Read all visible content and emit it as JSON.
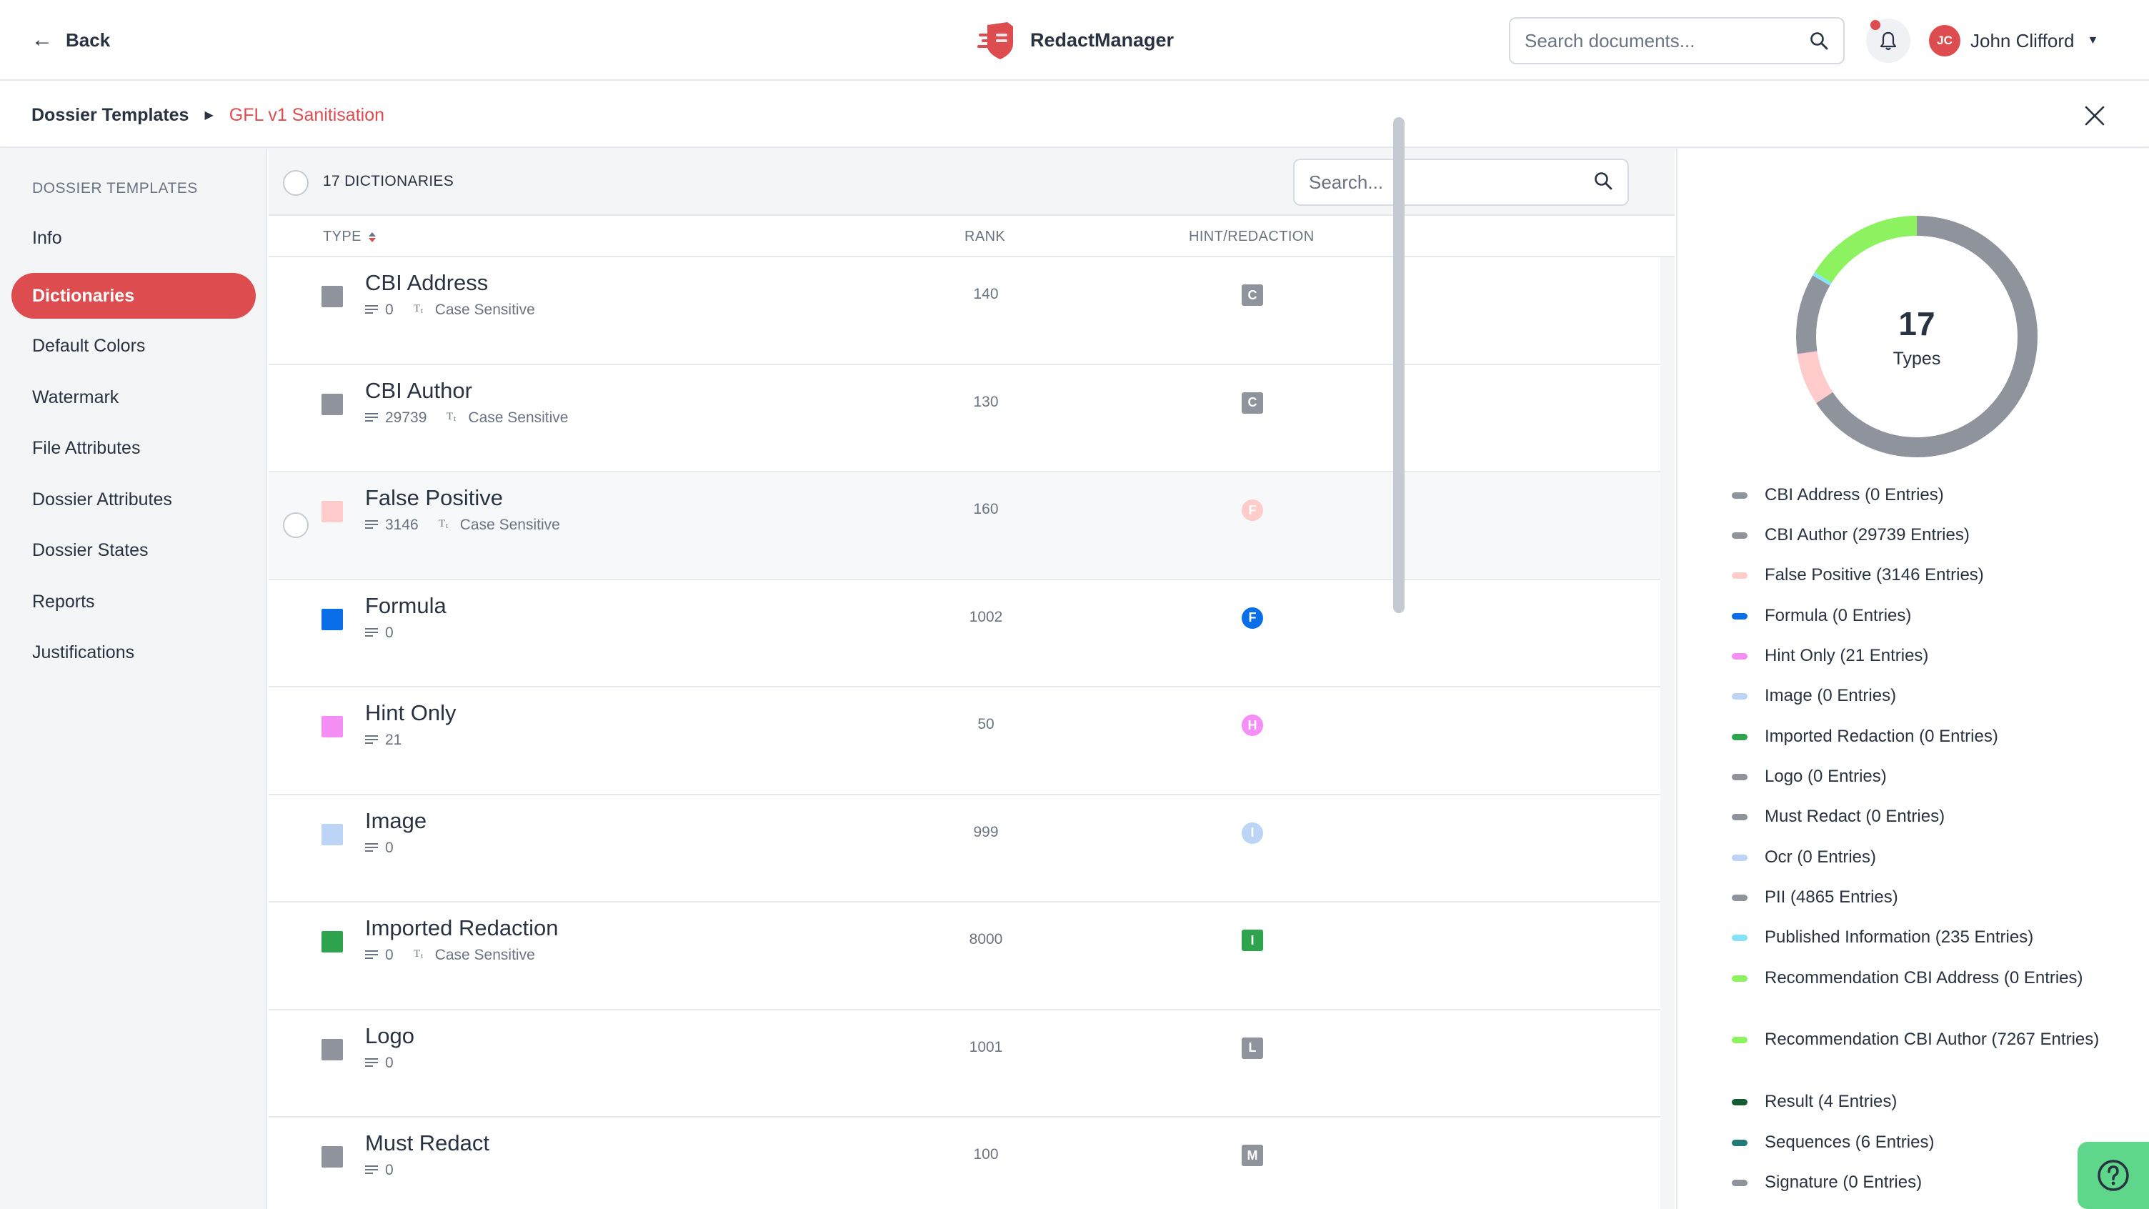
{
  "header": {
    "back_label": "Back",
    "brand_name": "RedactManager",
    "search_placeholder": "Search documents...",
    "user_initials": "JC",
    "user_name": "John Clifford",
    "accent_color": "#dd4d50"
  },
  "breadcrumb": {
    "root": "Dossier Templates",
    "current": "GFL v1 Sanitisation"
  },
  "sidebar": {
    "heading": "DOSSIER TEMPLATES",
    "items": [
      {
        "label": "Info",
        "active": false
      },
      {
        "label": "Dictionaries",
        "active": true
      },
      {
        "label": "Default Colors",
        "active": false
      },
      {
        "label": "Watermark",
        "active": false
      },
      {
        "label": "File Attributes",
        "active": false
      },
      {
        "label": "Dossier Attributes",
        "active": false
      },
      {
        "label": "Dossier States",
        "active": false
      },
      {
        "label": "Reports",
        "active": false
      },
      {
        "label": "Justifications",
        "active": false
      }
    ]
  },
  "table": {
    "count_label": "17 DICTIONARIES",
    "search_placeholder": "Search...",
    "columns": {
      "type": "TYPE",
      "rank": "RANK",
      "hint": "HINT/REDACTION"
    },
    "case_label": "Case Sensitive",
    "rows": [
      {
        "name": "CBI Address",
        "entries": "0",
        "case_sensitive": true,
        "rank": "140",
        "badge": "C",
        "badge_shape": "square",
        "color": "#8f939b",
        "hovered": false
      },
      {
        "name": "CBI Author",
        "entries": "29739",
        "case_sensitive": true,
        "rank": "130",
        "badge": "C",
        "badge_shape": "square",
        "color": "#8f939b",
        "hovered": false
      },
      {
        "name": "False Positive",
        "entries": "3146",
        "case_sensitive": true,
        "rank": "160",
        "badge": "F",
        "badge_shape": "circle",
        "color": "#ffcbcb",
        "hovered": true
      },
      {
        "name": "Formula",
        "entries": "0",
        "case_sensitive": false,
        "rank": "1002",
        "badge": "F",
        "badge_shape": "circle",
        "color": "#0a6ee8",
        "hovered": false
      },
      {
        "name": "Hint Only",
        "entries": "21",
        "case_sensitive": false,
        "rank": "50",
        "badge": "H",
        "badge_shape": "circle",
        "color": "#f58ef5",
        "hovered": false
      },
      {
        "name": "Image",
        "entries": "0",
        "case_sensitive": false,
        "rank": "999",
        "badge": "I",
        "badge_shape": "circle",
        "color": "#bcd4f6",
        "hovered": false
      },
      {
        "name": "Imported Redaction",
        "entries": "0",
        "case_sensitive": true,
        "rank": "8000",
        "badge": "I",
        "badge_shape": "square",
        "color": "#2ea44f",
        "hovered": false
      },
      {
        "name": "Logo",
        "entries": "0",
        "case_sensitive": false,
        "rank": "1001",
        "badge": "L",
        "badge_shape": "square",
        "color": "#8f939b",
        "hovered": false
      },
      {
        "name": "Must Redact",
        "entries": "0",
        "case_sensitive": false,
        "rank": "100",
        "badge": "M",
        "badge_shape": "square",
        "color": "#8f939b",
        "hovered": false
      }
    ]
  },
  "summary": {
    "total": "17",
    "total_label": "Types",
    "legend": [
      {
        "label": "CBI Address (0 Entries)",
        "color": "#8f939b"
      },
      {
        "label": "CBI Author (29739 Entries)",
        "color": "#8f939b"
      },
      {
        "label": "False Positive (3146 Entries)",
        "color": "#ffcbcb"
      },
      {
        "label": "Formula (0 Entries)",
        "color": "#0a6ee8"
      },
      {
        "label": "Hint Only (21 Entries)",
        "color": "#f58ef5"
      },
      {
        "label": "Image (0 Entries)",
        "color": "#bcd4f6"
      },
      {
        "label": "Imported Redaction (0 Entries)",
        "color": "#2ea44f"
      },
      {
        "label": "Logo (0 Entries)",
        "color": "#8f939b"
      },
      {
        "label": "Must Redact (0 Entries)",
        "color": "#8f939b"
      },
      {
        "label": "Ocr (0 Entries)",
        "color": "#bcd4f6"
      },
      {
        "label": "PII (4865 Entries)",
        "color": "#8f939b"
      },
      {
        "label": "Published Information (235 Entries)",
        "color": "#85e2f7"
      },
      {
        "label": "Recommendation CBI Address (0 Entries)",
        "color": "#8cf25f"
      },
      {
        "label": "Recommendation CBI Author (7267 Entries)",
        "color": "#8cf25f"
      },
      {
        "label": "Result (4 Entries)",
        "color": "#145a32"
      },
      {
        "label": "Sequences (6 Entries)",
        "color": "#23787a"
      },
      {
        "label": "Signature (0 Entries)",
        "color": "#8f939b"
      }
    ],
    "donut_segments": [
      {
        "name": "CBI Author",
        "value": 29739,
        "color": "#8f939b"
      },
      {
        "name": "False Positive",
        "value": 3146,
        "color": "#ffcbcb"
      },
      {
        "name": "Hint Only",
        "value": 21,
        "color": "#f58ef5"
      },
      {
        "name": "PII",
        "value": 4865,
        "color": "#8f939b"
      },
      {
        "name": "Published Information",
        "value": 235,
        "color": "#85e2f7"
      },
      {
        "name": "Recommendation CBI Author",
        "value": 7267,
        "color": "#8cf25f"
      },
      {
        "name": "Result",
        "value": 4,
        "color": "#145a32"
      },
      {
        "name": "Sequences",
        "value": 6,
        "color": "#23787a"
      }
    ]
  }
}
